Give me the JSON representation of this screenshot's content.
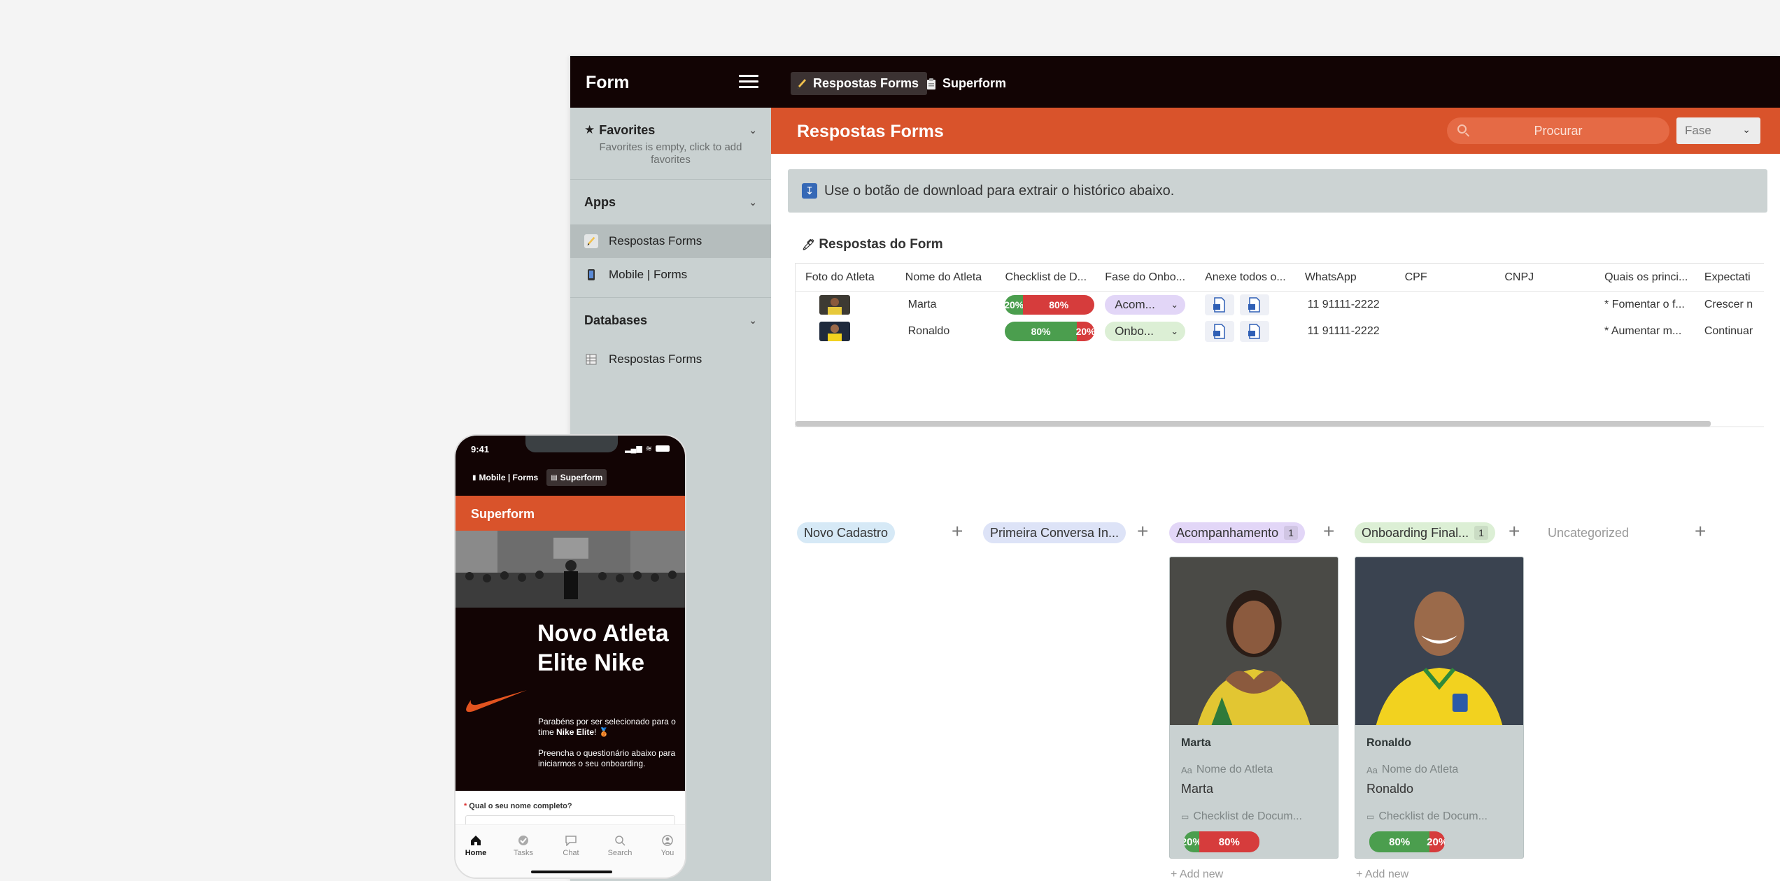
{
  "app": {
    "title": "Form"
  },
  "tabs": [
    {
      "label": "Respostas Forms",
      "icon": "pencil-icon",
      "active": true
    },
    {
      "label": "Superform",
      "icon": "clipboard-icon",
      "active": false
    }
  ],
  "sidebar": {
    "favorites": {
      "title": "Favorites",
      "empty_text": "Favorites is empty, click to add favorites"
    },
    "apps": {
      "title": "Apps",
      "items": [
        {
          "label": "Respostas Forms",
          "selected": true
        },
        {
          "label": "Mobile | Forms",
          "selected": false
        }
      ]
    },
    "databases": {
      "title": "Databases",
      "items": [
        {
          "label": "Respostas Forms"
        }
      ]
    }
  },
  "header": {
    "title": "Respostas Forms",
    "search_placeholder": "Procurar",
    "filter_label": "Fase"
  },
  "notice": {
    "text": "Use o botão de download para extrair o histórico abaixo."
  },
  "table": {
    "title": "Respostas do Form",
    "columns": [
      "Foto do Atleta",
      "Nome do Atleta",
      "Checklist de D...",
      "Fase do Onbo...",
      "Anexe todos o...",
      "WhatsApp",
      "CPF",
      "CNPJ",
      "Quais os princi...",
      "Expectati"
    ],
    "rows": [
      {
        "name": "Marta",
        "checklist_green": "20%",
        "checklist_red": "80%",
        "green_pct": 20,
        "phase": "Acom...",
        "whatsapp": "11 91111-2222",
        "cpf": "",
        "cnpj": "",
        "quais": "* Fomentar o f...",
        "expect": "Crescer n"
      },
      {
        "name": "Ronaldo",
        "checklist_green": "80%",
        "checklist_red": "20%",
        "green_pct": 80,
        "phase": "Onbo...",
        "whatsapp": "11 91111-2222",
        "cpf": "",
        "cnpj": "",
        "quais": "* Aumentar m...",
        "expect": "Continuar"
      }
    ]
  },
  "kanban": {
    "columns": [
      {
        "label": "Novo Cadastro",
        "count": "",
        "color": "#d6e9f6"
      },
      {
        "label": "Primeira Conversa In...",
        "count": "",
        "color": "#dde3f7"
      },
      {
        "label": "Acompanhamento",
        "count": "1",
        "color": "#e2d6f7"
      },
      {
        "label": "Onboarding Final...",
        "count": "1",
        "color": "#dcefd5"
      },
      {
        "label": "Uncategorized",
        "count": "",
        "color": ""
      }
    ],
    "cards": [
      {
        "name": "Marta",
        "field_label": "Nome do Atleta",
        "field_value": "Marta",
        "checklist_label": "Checklist de Docum...",
        "green": "20%",
        "red": "80%",
        "green_pct": 20
      },
      {
        "name": "Ronaldo",
        "field_label": "Nome do Atleta",
        "field_value": "Ronaldo",
        "checklist_label": "Checklist de Docum...",
        "green": "80%",
        "red": "20%",
        "green_pct": 80
      }
    ],
    "add_new": "Add new"
  },
  "phone": {
    "time": "9:41",
    "tabs": [
      {
        "label": "Mobile | Forms"
      },
      {
        "label": "Superform"
      }
    ],
    "banner": "Superform",
    "headline": "Novo Atleta Elite Nike",
    "para1_a": "Parabéns por ser selecionado para o time ",
    "para1_b": "Nike Elite",
    "para1_c": "! 🥉",
    "para2": "Preencha o questionário abaixo para iniciarmos o seu onboarding.",
    "question": "Qual o seu nome completo?",
    "nav": [
      "Home",
      "Tasks",
      "Chat",
      "Search",
      "You"
    ]
  },
  "colors": {
    "accent": "#d9532b",
    "dark": "#120404",
    "sidebar": "#c9d1d1",
    "green": "#4b9e4e",
    "red": "#d63c3c"
  }
}
